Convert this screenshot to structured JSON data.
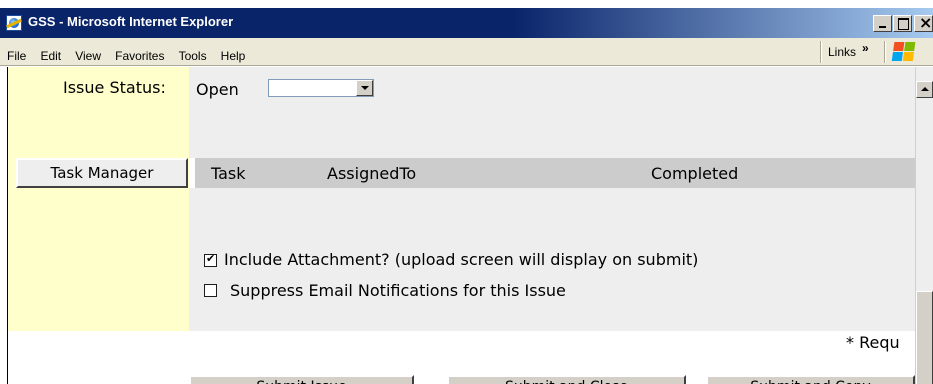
{
  "window": {
    "title": "GSS - Microsoft Internet Explorer"
  },
  "menubar": {
    "items": [
      "File",
      "Edit",
      "View",
      "Favorites",
      "Tools",
      "Help"
    ],
    "links_label": "Links",
    "links_chevron": "»"
  },
  "form": {
    "issue_status_label": "Issue Status:",
    "issue_status_value": "Open",
    "task_manager_button": "Task Manager",
    "task_table": {
      "columns": [
        "Task",
        "AssignedTo",
        "Completed"
      ]
    },
    "include_attachment": {
      "label": "Include Attachment? (upload screen will display on submit)",
      "checked": true
    },
    "suppress_email": {
      "label": "Suppress Email Notifications for this Issue",
      "checked": false
    },
    "required_note": "* Requ",
    "bottom_buttons": [
      "Submit Issue",
      "Submit and Close",
      "Submit and Copy"
    ]
  }
}
